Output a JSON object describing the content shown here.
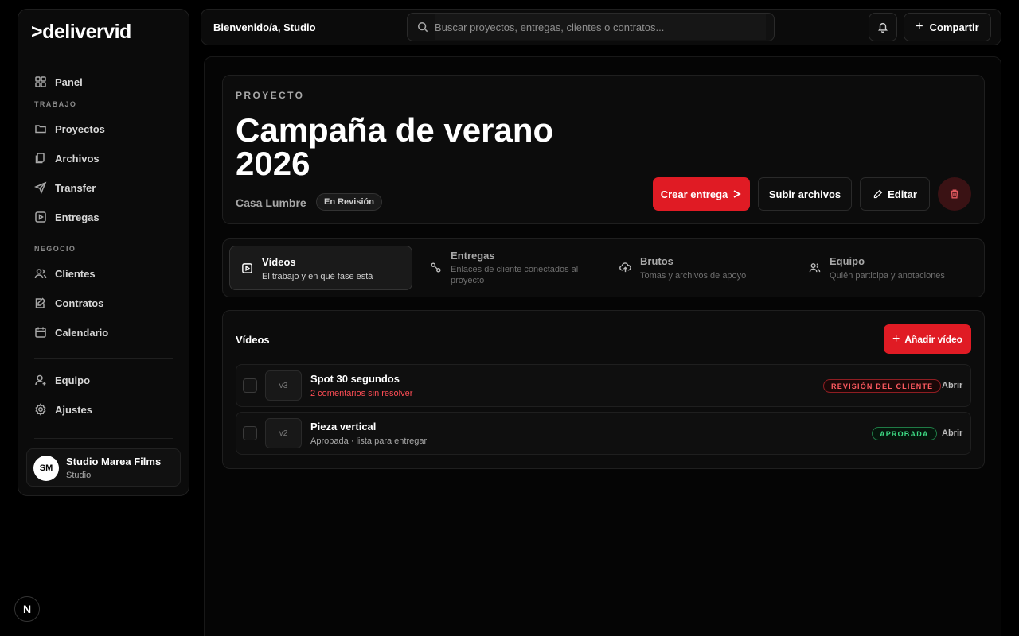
{
  "app": {
    "logo": ">delivervid"
  },
  "sidebar": {
    "panel": "Panel",
    "section_work": "TRABAJO",
    "work_items": [
      "Proyectos",
      "Archivos",
      "Transfer",
      "Entregas"
    ],
    "section_business": "NEGOCIO",
    "business_items": [
      "Clientes",
      "Contratos",
      "Calendario"
    ],
    "team": "Equipo",
    "settings": "Ajustes",
    "account": {
      "initials": "SM",
      "name": "Studio Marea Films",
      "role": "Studio"
    }
  },
  "topbar": {
    "welcome": "Bienvenido/a, Studio",
    "search_placeholder": "Buscar proyectos, entregas, clientes o contratos...",
    "share_label": "Compartir"
  },
  "project": {
    "eyebrow": "PROYECTO",
    "title": "Campaña de verano 2026",
    "client": "Casa Lumbre",
    "status": "En Revisión",
    "create_delivery": "Crear entrega",
    "upload_files": "Subir archivos",
    "edit": "Editar"
  },
  "tabs": [
    {
      "label": "Vídeos",
      "sub": "El trabajo y en qué fase está"
    },
    {
      "label": "Entregas",
      "sub": "Enlaces de cliente conectados al proyecto"
    },
    {
      "label": "Brutos",
      "sub": "Tomas y archivos de apoyo"
    },
    {
      "label": "Equipo",
      "sub": "Quién participa y anotaciones"
    }
  ],
  "videos": {
    "title": "Vídeos",
    "add_label": "Añadir vídeo",
    "open_label": "Abrir",
    "rows": [
      {
        "version": "v3",
        "title": "Spot 30 segundos",
        "sub": "2 comentarios sin resolver",
        "status": "REVISIÓN DEL CLIENTE"
      },
      {
        "version": "v2",
        "title": "Pieza vertical",
        "sub": "Aprobada · lista para entregar",
        "status": "APROBADA"
      }
    ]
  },
  "colors": {
    "accent_red": "#e01b24",
    "warning_red": "#ff4d55",
    "success_green": "#3ddc84"
  },
  "misc": {
    "framework_badge": "N"
  }
}
